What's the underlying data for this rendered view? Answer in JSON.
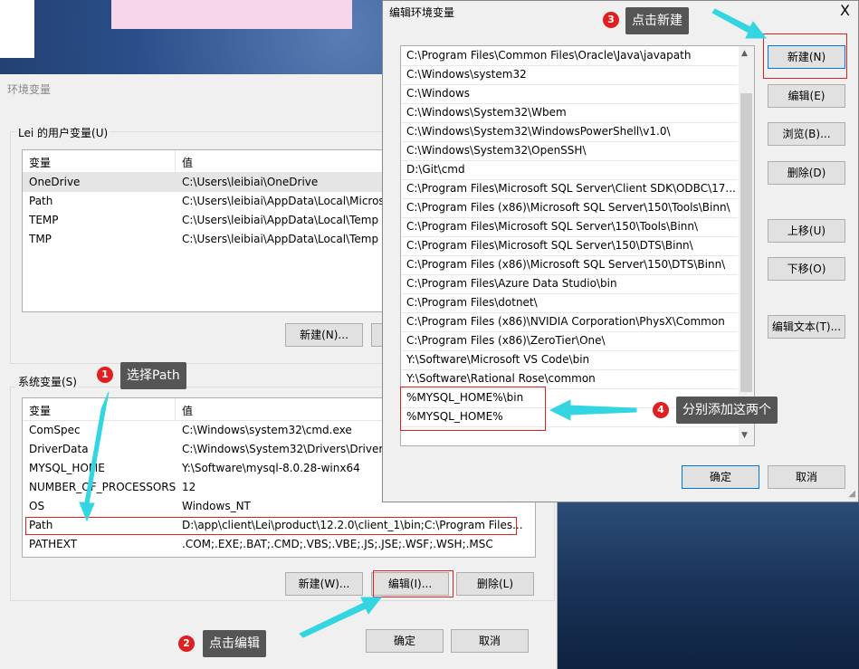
{
  "env_dialog": {
    "title": "环境变量",
    "user_group_label": "Lei 的用户变量(U)",
    "col_var": "变量",
    "col_val": "值",
    "user_vars": [
      {
        "name": "OneDrive",
        "value": "C:\\Users\\leibiai\\OneDrive"
      },
      {
        "name": "Path",
        "value": "C:\\Users\\leibiai\\AppData\\Local\\Micros"
      },
      {
        "name": "TEMP",
        "value": "C:\\Users\\leibiai\\AppData\\Local\\Temp"
      },
      {
        "name": "TMP",
        "value": "C:\\Users\\leibiai\\AppData\\Local\\Temp"
      }
    ],
    "user_new_button": "新建(N)...",
    "system_group_label": "系统变量(S)",
    "system_vars": [
      {
        "name": "ComSpec",
        "value": "C:\\Windows\\system32\\cmd.exe"
      },
      {
        "name": "DriverData",
        "value": "C:\\Windows\\System32\\Drivers\\DriverD"
      },
      {
        "name": "MYSQL_HOME",
        "value": "Y:\\Software\\mysql-8.0.28-winx64"
      },
      {
        "name": "NUMBER_OF_PROCESSORS",
        "value": "12"
      },
      {
        "name": "OS",
        "value": "Windows_NT"
      },
      {
        "name": "Path",
        "value": "D:\\app\\client\\Lei\\product\\12.2.0\\client_1\\bin;C:\\Program Files..."
      },
      {
        "name": "PATHEXT",
        "value": ".COM;.EXE;.BAT;.CMD;.VBS;.VBE;.JS;.JSE;.WSF;.WSH;.MSC"
      }
    ],
    "sys_new_button": "新建(W)...",
    "sys_edit_button": "编辑(I)...",
    "sys_delete_button": "删除(L)",
    "ok_button": "确定",
    "cancel_button": "取消"
  },
  "edit_dialog": {
    "title": "编辑环境变量",
    "close_label": "X",
    "paths": [
      "C:\\Program Files\\Common Files\\Oracle\\Java\\javapath",
      "C:\\Windows\\system32",
      "C:\\Windows",
      "C:\\Windows\\System32\\Wbem",
      "C:\\Windows\\System32\\WindowsPowerShell\\v1.0\\",
      "C:\\Windows\\System32\\OpenSSH\\",
      "D:\\Git\\cmd",
      "C:\\Program Files\\Microsoft SQL Server\\Client SDK\\ODBC\\17...",
      "C:\\Program Files (x86)\\Microsoft SQL Server\\150\\Tools\\Binn\\",
      "C:\\Program Files\\Microsoft SQL Server\\150\\Tools\\Binn\\",
      "C:\\Program Files\\Microsoft SQL Server\\150\\DTS\\Binn\\",
      "C:\\Program Files (x86)\\Microsoft SQL Server\\150\\DTS\\Binn\\",
      "C:\\Program Files\\Azure Data Studio\\bin",
      "C:\\Program Files\\dotnet\\",
      "C:\\Program Files (x86)\\NVIDIA Corporation\\PhysX\\Common",
      "C:\\Program Files (x86)\\ZeroTier\\One\\",
      "Y:\\Software\\Microsoft VS Code\\bin",
      "Y:\\Software\\Rational Rose\\common",
      "%MYSQL_HOME%\\bin",
      "%MYSQL_HOME%"
    ],
    "buttons": {
      "new": "新建(N)",
      "edit": "编辑(E)",
      "browse": "浏览(B)...",
      "delete": "删除(D)",
      "move_up": "上移(U)",
      "move_down": "下移(O)",
      "edit_text": "编辑文本(T)...",
      "ok": "确定",
      "cancel": "取消"
    }
  },
  "annotations": [
    {
      "num": "1",
      "text": "选择Path"
    },
    {
      "num": "2",
      "text": "点击编辑"
    },
    {
      "num": "3",
      "text": "点击新建"
    },
    {
      "num": "4",
      "text": "分别添加这两个"
    }
  ],
  "colors": {
    "annotation_red": "#e02020",
    "arrow_cyan": "#33d6e0",
    "callout_bg": "#555555"
  }
}
